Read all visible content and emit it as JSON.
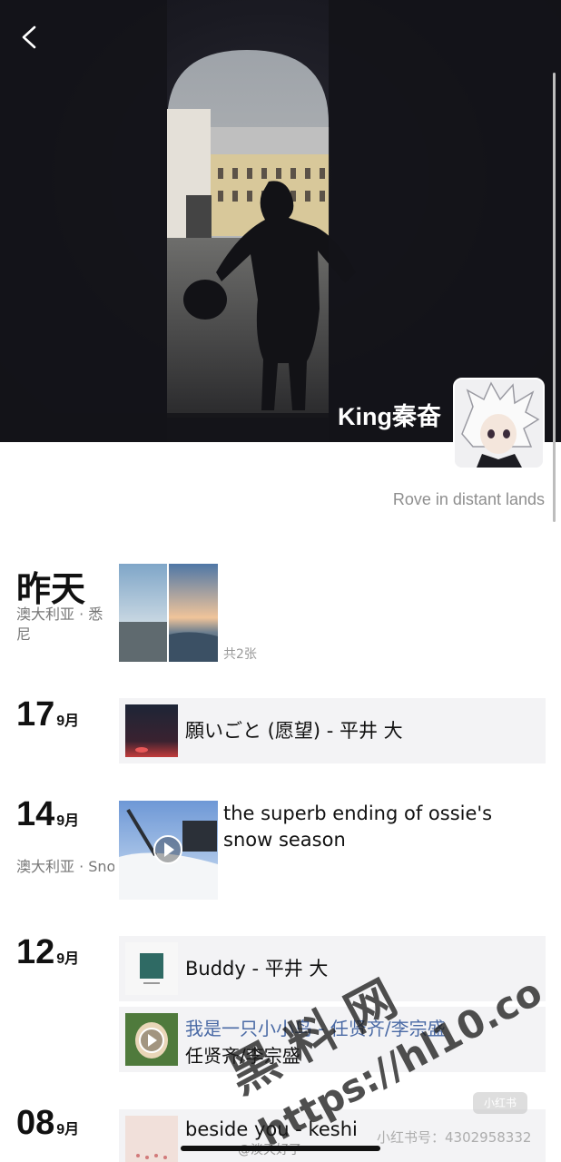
{
  "header": {
    "back_icon": "chevron-left-icon",
    "name": "King秦奋",
    "signature": "Rove in distant lands"
  },
  "timeline": [
    {
      "day": "昨天",
      "location": "澳大利亚 · 悉尼",
      "photo_count": "共2张"
    },
    {
      "day": "17",
      "month": "9月",
      "music": "願いごと (愿望) - 平井 大"
    },
    {
      "day": "14",
      "month": "9月",
      "location": "澳大利亚 · Snowy Ri...",
      "text": "the superb ending of ossie's snow season"
    },
    {
      "day": "12",
      "month": "9月",
      "music": "Buddy - 平井 大",
      "video_title": "我是一只小小鸟 - 任贤齐/李宗盛",
      "video_subtitle": "任贤齐/李宗盛"
    },
    {
      "day": "08",
      "month": "9月",
      "music": "beside you - keshi"
    }
  ],
  "watermarks": {
    "main": "黑 料 网",
    "url": "https://hl10.co",
    "xhs_id": "小红书号：4302958332",
    "badge": "小红书",
    "weibo": "@淡天好了"
  },
  "colors": {
    "card_bg": "#f3f3f5",
    "link_blue": "#4a6aa5",
    "muted": "#8e8e8e"
  }
}
